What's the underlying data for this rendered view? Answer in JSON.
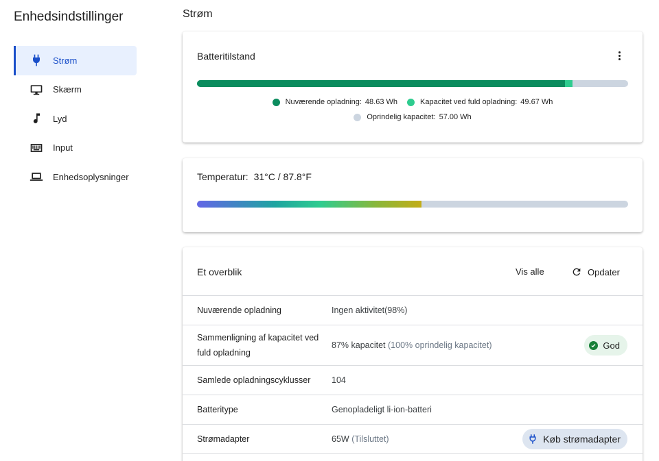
{
  "sidebar": {
    "title": "Enhedsindstillinger",
    "items": [
      {
        "label": "Strøm",
        "icon": "plug-icon",
        "active": true
      },
      {
        "label": "Skærm",
        "icon": "monitor-icon"
      },
      {
        "label": "Lyd",
        "icon": "music-note-icon"
      },
      {
        "label": "Input",
        "icon": "keyboard-icon"
      },
      {
        "label": "Enhedsoplysninger",
        "icon": "laptop-icon"
      }
    ]
  },
  "main": {
    "page_title": "Strøm",
    "battery": {
      "title": "Batteritilstand",
      "menu_icon": "more-vert-icon",
      "current_charge_label": "Nuværende opladning:",
      "current_charge_value": "48.63 Wh",
      "full_capacity_label": "Kapacitet ved fuld opladning:",
      "full_capacity_value": "49.67 Wh",
      "original_capacity_label": "Oprindelig kapacitet:",
      "original_capacity_value": "57.00 Wh",
      "colors": {
        "current": "#0b8c5e",
        "full": "#2ecc8f",
        "original": "#ccd5e0"
      }
    },
    "temperature": {
      "label": "Temperatur:",
      "value": "31°C / 87.8°F",
      "level_fraction": 0.52
    },
    "overview": {
      "title": "Et overblik",
      "view_all_label": "Vis alle",
      "refresh_label": "Opdater",
      "rows": [
        {
          "label": "Nuværende opladning",
          "value": "Ingen aktivitet(98%)",
          "extra": ""
        },
        {
          "label": "Sammenligning af kapacitet ved fuld opladning",
          "value": "87% kapacitet",
          "extra": "(100% oprindelig kapacitet)"
        },
        {
          "label": "Samlede opladningscyklusser",
          "value": "104",
          "extra": ""
        },
        {
          "label": "Batteritype",
          "value": "Genopladeligt li-ion-batteri",
          "extra": ""
        },
        {
          "label": "Strømadapter",
          "value": "65W",
          "extra": "(Tilsluttet)"
        }
      ],
      "good_chip_label": "God",
      "buy_adapter_label": "Køb strømadapter"
    }
  }
}
